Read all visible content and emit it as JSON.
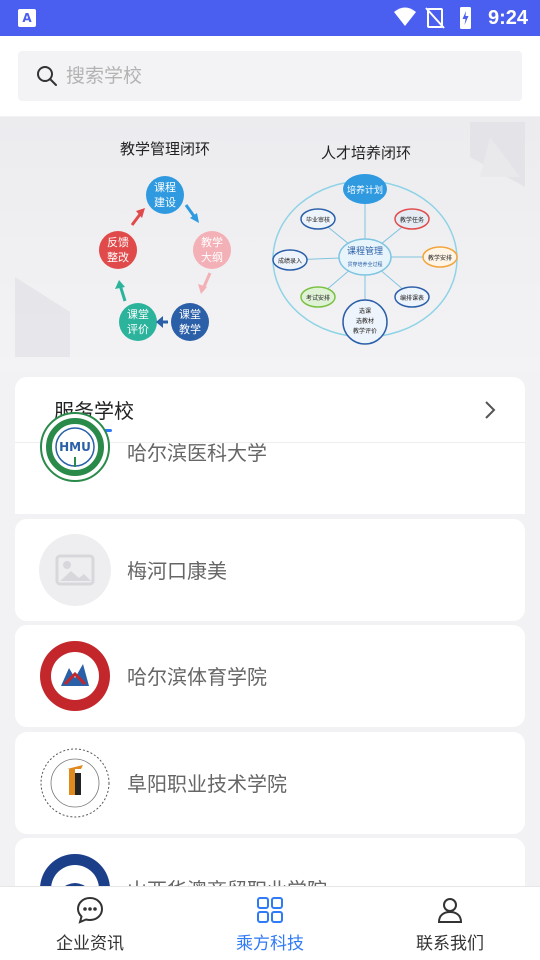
{
  "status_bar": {
    "time": "9:24"
  },
  "search": {
    "placeholder": "搜索学校"
  },
  "banner": {
    "left_title": "教学管理闭环",
    "left_nodes": [
      "课程\n建设",
      "教学\n大纲",
      "课堂\n教学",
      "课堂\n评价",
      "反馈\n整改"
    ],
    "right_title": "人才培养闭环",
    "right_center": "课程管理",
    "right_nodes": [
      "培养计划",
      "教学任务",
      "教学安排",
      "编排教表",
      "选课\n选教材\n教学评价",
      "考试安排",
      "成绩录入",
      "毕业审核"
    ]
  },
  "section": {
    "title": "服务学校"
  },
  "schools": [
    {
      "name": "哈尔滨医科大学",
      "logo": "hmu-logo"
    },
    {
      "name": "梅河口康美",
      "logo": "placeholder-image"
    },
    {
      "name": "哈尔滨体育学院",
      "logo": "hsu-logo"
    },
    {
      "name": "阜阳职业技术学院",
      "logo": "fuyang-logo"
    },
    {
      "name": "山西华澳商贸职业学院",
      "logo": "shanxi-logo"
    }
  ],
  "bottom_nav": [
    {
      "label": "企业资讯",
      "icon": "chat-bubble-icon",
      "active": false
    },
    {
      "label": "乘方科技",
      "icon": "grid-icon",
      "active": true
    },
    {
      "label": "联系我们",
      "icon": "person-icon",
      "active": false
    }
  ],
  "colors": {
    "accent": "#2f7af6",
    "status_bar": "#4a5ef0"
  }
}
